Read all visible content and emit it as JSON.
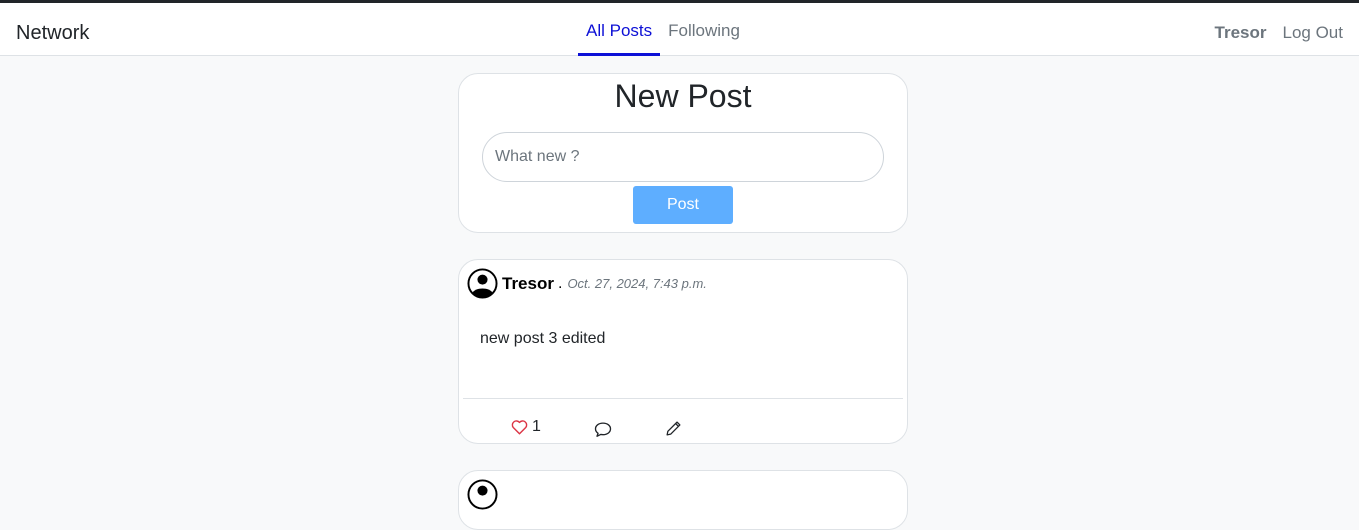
{
  "nav": {
    "brand": "Network",
    "tabs": [
      {
        "label": "All Posts",
        "active": true
      },
      {
        "label": "Following",
        "active": false
      }
    ],
    "user": "Tresor",
    "logout": "Log Out"
  },
  "new_post": {
    "title": "New Post",
    "placeholder": "What new ?",
    "button": "Post"
  },
  "posts": [
    {
      "author": "Tresor",
      "separator": ".",
      "timestamp": "Oct. 27, 2024, 7:43 p.m.",
      "content": "new post 3 edited",
      "likes": "1"
    }
  ],
  "colors": {
    "accent": "#0d10d6",
    "button": "#5eaeff",
    "like": "#dc3545",
    "page_bg": "#f8f9fa"
  },
  "icons": [
    "user-circle-icon",
    "heart-icon",
    "comment-icon",
    "pencil-icon"
  ]
}
